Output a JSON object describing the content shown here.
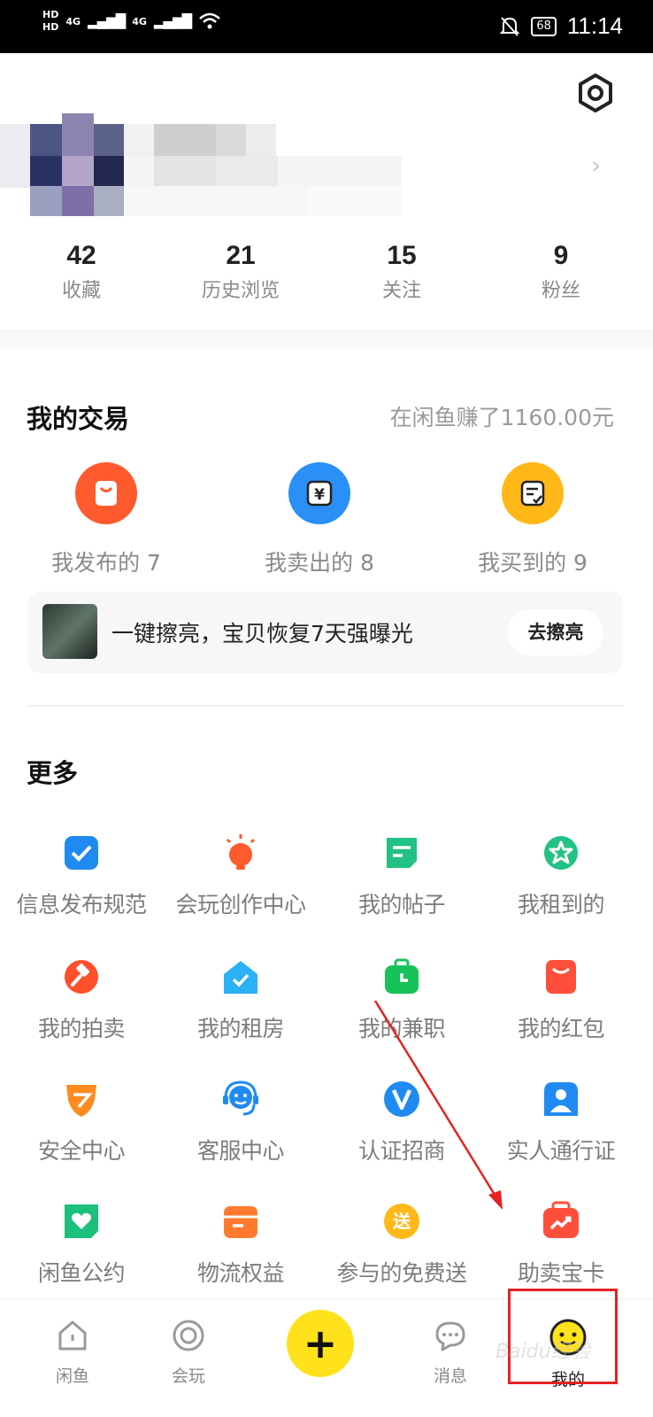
{
  "status_bar": {
    "network_left": "HD",
    "network_sub": "4G",
    "battery": "68",
    "time": "11:14"
  },
  "profile": {
    "stats": [
      {
        "value": "42",
        "label": "收藏"
      },
      {
        "value": "21",
        "label": "历史浏览"
      },
      {
        "value": "15",
        "label": "关注"
      },
      {
        "value": "9",
        "label": "粉丝"
      }
    ]
  },
  "trade": {
    "title": "我的交易",
    "earned": "在闲鱼赚了1160.00元",
    "items": [
      {
        "label": "我发布的 7",
        "icon": "bag-icon",
        "color": "#ff5a2e"
      },
      {
        "label": "我卖出的 8",
        "icon": "yen-icon",
        "color": "#2a8ff7"
      },
      {
        "label": "我买到的 9",
        "icon": "order-icon",
        "color": "#ffb818"
      }
    ],
    "banner": {
      "text": "一键擦亮，宝贝恢复7天强曝光",
      "button": "去擦亮"
    }
  },
  "more": {
    "title": "更多",
    "items": [
      {
        "label": "信息发布规范",
        "icon": "check-badge-icon",
        "color": "#1f8bf2"
      },
      {
        "label": "会玩创作中心",
        "icon": "bulb-icon",
        "color": "#ff5a2e"
      },
      {
        "label": "我的帖子",
        "icon": "post-icon",
        "color": "#22c184"
      },
      {
        "label": "我租到的",
        "icon": "star-badge-icon",
        "color": "#22c184"
      },
      {
        "label": "我的拍卖",
        "icon": "hammer-icon",
        "color": "#ff4f2b"
      },
      {
        "label": "我的租房",
        "icon": "house-icon",
        "color": "#2bb1f5"
      },
      {
        "label": "我的兼职",
        "icon": "briefcase-icon",
        "color": "#18c25a"
      },
      {
        "label": "我的红包",
        "icon": "red-packet-icon",
        "color": "#ff4f3b"
      },
      {
        "label": "安全中心",
        "icon": "shield-icon",
        "color": "#ff8a1e"
      },
      {
        "label": "客服中心",
        "icon": "headset-icon",
        "color": "#1f8bf2"
      },
      {
        "label": "认证招商",
        "icon": "verified-v-icon",
        "color": "#1f8bf2"
      },
      {
        "label": "实人通行证",
        "icon": "person-icon",
        "color": "#1f8bf2"
      },
      {
        "label": "闲鱼公约",
        "icon": "heart-doc-icon",
        "color": "#1bc07a"
      },
      {
        "label": "物流权益",
        "icon": "box-icon",
        "color": "#ff7a2e"
      },
      {
        "label": "参与的免费送",
        "icon": "gift-tag-icon",
        "color": "#ffb818",
        "tag": "送"
      },
      {
        "label": "助卖宝卡",
        "icon": "boost-card-icon",
        "color": "#ff4f3b"
      }
    ]
  },
  "bottom_nav": {
    "items": [
      {
        "label": "闲鱼",
        "icon": "home-icon"
      },
      {
        "label": "会玩",
        "icon": "circle-play-icon"
      },
      {
        "label": "消息",
        "icon": "chat-icon"
      },
      {
        "label": "我的",
        "icon": "profile-face-icon"
      }
    ],
    "post_icon": "plus-icon"
  },
  "watermark": "Baidu经验"
}
